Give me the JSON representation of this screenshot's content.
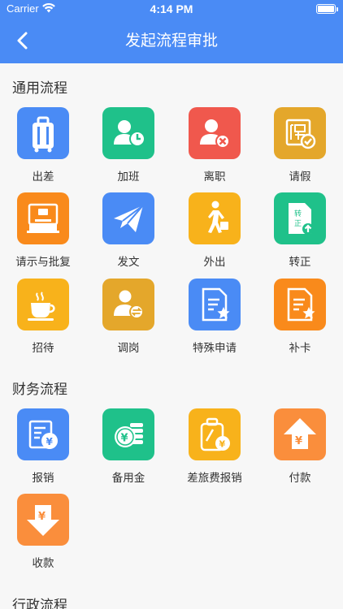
{
  "status_bar": {
    "carrier": "Carrier",
    "time": "4:14 PM"
  },
  "nav": {
    "title": "发起流程审批",
    "back_icon": "chevron-left-icon"
  },
  "colors": {
    "nav_bg": "#4a8bf5",
    "blue": "#4a8bf5",
    "green": "#1fc18a",
    "red": "#f0584d",
    "gold": "#e4a72b",
    "orange": "#f98a1b",
    "amber": "#f8b21b",
    "light_orange": "#fa8e3c"
  },
  "sections": [
    {
      "title": "通用流程",
      "items": [
        {
          "label": "出差",
          "icon": "luggage-icon",
          "color": "#4a8bf5"
        },
        {
          "label": "加班",
          "icon": "person-clock-icon",
          "color": "#1fc18a"
        },
        {
          "label": "离职",
          "icon": "person-remove-icon",
          "color": "#f0584d"
        },
        {
          "label": "请假",
          "icon": "leave-stamp-icon",
          "color": "#e4a72b"
        },
        {
          "label": "请示与批复",
          "icon": "stamp-icon",
          "color": "#f98a1b"
        },
        {
          "label": "发文",
          "icon": "paper-plane-icon",
          "color": "#4a8bf5"
        },
        {
          "label": "外出",
          "icon": "walking-person-icon",
          "color": "#f8b21b"
        },
        {
          "label": "转正",
          "icon": "document-up-icon",
          "color": "#1fc18a"
        },
        {
          "label": "招待",
          "icon": "coffee-cup-icon",
          "color": "#f8b21b"
        },
        {
          "label": "调岗",
          "icon": "person-swap-icon",
          "color": "#e4a72b"
        },
        {
          "label": "特殊申请",
          "icon": "document-star-icon",
          "color": "#4a8bf5"
        },
        {
          "label": "补卡",
          "icon": "document-star-icon",
          "color": "#f98a1b"
        }
      ]
    },
    {
      "title": "财务流程",
      "items": [
        {
          "label": "报销",
          "icon": "yuan-document-icon",
          "color": "#4a8bf5"
        },
        {
          "label": "备用金",
          "icon": "yuan-coins-icon",
          "color": "#1fc18a"
        },
        {
          "label": "差旅费报销",
          "icon": "luggage-yuan-icon",
          "color": "#f8b21b"
        },
        {
          "label": "付款",
          "icon": "yuan-arrow-up-icon",
          "color": "#fa8e3c"
        },
        {
          "label": "收款",
          "icon": "yuan-arrow-down-icon",
          "color": "#fa8e3c"
        }
      ]
    },
    {
      "title": "行政流程",
      "items": []
    }
  ]
}
